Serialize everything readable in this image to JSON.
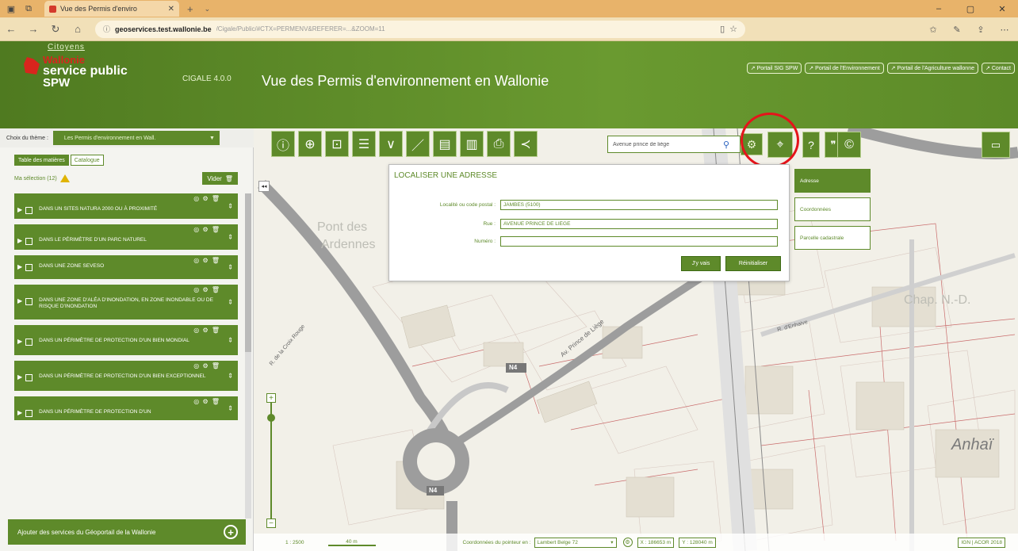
{
  "browser": {
    "tab_title": "Vue des Permis d'enviro",
    "url_host": "geoservices.test.wallonie.be",
    "url_path": "/Cigale/Public/#CTX=PERMENV&REFERER=...&ZOOM=11",
    "win_min": "–",
    "win_max": "▢",
    "win_close": "✕"
  },
  "header": {
    "citoyens": "Citoyens",
    "logo_line1": "Wallonie",
    "logo_line2": "service public",
    "logo_line3": "SPW",
    "version": "CIGALE 4.0.0",
    "title": "Vue des Permis d'environnement en Wallonie",
    "portals": [
      "Portail SIG SPW",
      "Portail de l'Environnement",
      "Portail de l'Agriculture wallonne",
      "Contact"
    ]
  },
  "left": {
    "theme_label": "Choix du thème :",
    "theme_value": "Les Permis d'environnement en Wall.",
    "tab_active": "Table des matières",
    "tab_other": "Catalogue",
    "selection_label": "Ma sélection (12)",
    "vider_label": "Vider",
    "items": [
      "DANS UN SITES NATURA 2000 OU À PROXIMITÉ",
      "DANS LE PÉRIMÈTRE D'UN PARC NATUREL",
      "DANS UNE ZONE SEVESO",
      "DANS UNE ZONE D'ALÉA D'INONDATION, EN ZONE INONDABLE OU DE RISQUE D'INONDATION",
      "DANS UN PÉRIMÈTRE DE PROTECTION D'UN BIEN MONDIAL",
      "DANS UN PÉRIMÈTRE DE PROTECTION D'UN BIEN EXCEPTIONNEL",
      "DANS UN PÉRIMÈTRE DE PROTECTION D'UN"
    ],
    "add_services": "Ajouter des services du Géoportail de la Wallonie"
  },
  "toolbar": {
    "search_placeholder": "Avenue prince de liège"
  },
  "locate": {
    "title": "LOCALISER UNE ADRESSE",
    "locality_label": "Localité ou code postal :",
    "locality_value": "JAMBES (5100)",
    "street_label": "Rue :",
    "street_value": "AVENUE PRINCE DE LIÈGE",
    "number_label": "Numéro :",
    "number_value": "",
    "go_label": "J'y vais",
    "reset_label": "Réinitialiser",
    "tabs": [
      "Adresse",
      "Coordonnées",
      "Parcelle cadastrale"
    ]
  },
  "map": {
    "labels": [
      "Pont des",
      "Ardennes",
      "Chap. N.-D.",
      "Anhaï"
    ],
    "roads": [
      "Av. Prince de Liège",
      "R. d'Enhaive",
      "R. de la Croix Rouge",
      "N4",
      "N4"
    ]
  },
  "bottombar": {
    "scale": "1 : 2500",
    "scalebar": "40 m",
    "coord_label": "Coordonnées du pointeur en :",
    "projection": "Lambert Belge 72",
    "x": "X : 186653 m",
    "y": "Y : 128040 m",
    "credit": "IGN | ACOR 2018"
  }
}
